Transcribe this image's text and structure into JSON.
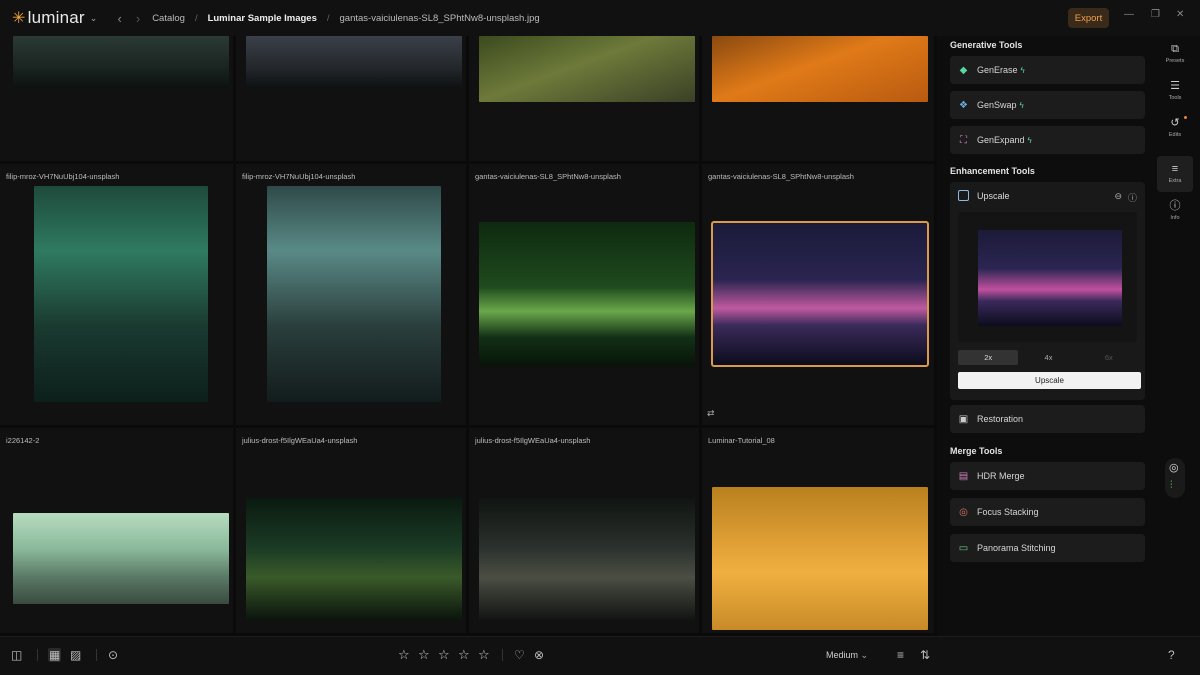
{
  "app": {
    "logo": "luminar"
  },
  "breadcrumbs": [
    "Catalog",
    "Luminar Sample Images",
    "gantas-vaiciulenas-SL8_SPhtNw8-unsplash.jpg"
  ],
  "topbar": {
    "export_label": "Export"
  },
  "grid": {
    "row2_labels": [
      "filip-mroz-VH7NuUbj104-unsplash",
      "filip-mroz-VH7NuUbj104-unsplash",
      "gantas-vaiciulenas-SL8_SPhtNw8-unsplash",
      "gantas-vaiciulenas-SL8_SPhtNw8-unsplash"
    ],
    "row3_labels": [
      "i226142-2",
      "julius-drost-f5IlgWEaUa4-unsplash",
      "julius-drost-f5IlgWEaUa4-unsplash",
      "Luminar-Tutorial_08"
    ]
  },
  "panel": {
    "generative_title": "Generative Tools",
    "generative": [
      "GenErase",
      "GenSwap",
      "GenExpand"
    ],
    "enhancement_title": "Enhancement Tools",
    "upscale": {
      "title": "Upscale",
      "scales": [
        "2x",
        "4x",
        "6x"
      ],
      "button": "Upscale"
    },
    "restoration": "Restoration",
    "merge_title": "Merge Tools",
    "merge": [
      "HDR Merge",
      "Focus Stacking",
      "Panorama Stitching"
    ]
  },
  "sidebar": {
    "items": [
      "Presets",
      "Tools",
      "Edits",
      "Extra",
      "Info"
    ]
  },
  "bottom": {
    "zoom_label": "Medium"
  },
  "colors": {
    "accent": "#f0a04a",
    "selection": "#d99a4a"
  }
}
